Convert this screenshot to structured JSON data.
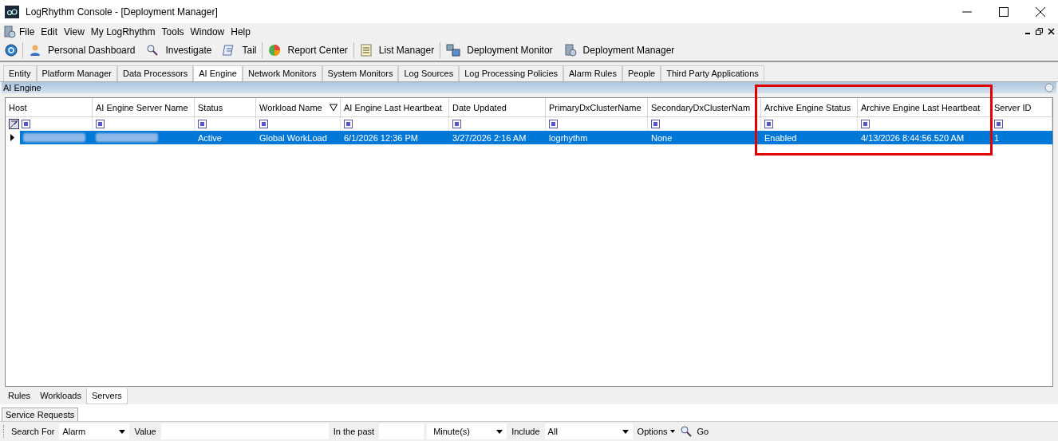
{
  "window": {
    "title": "LogRhythm Console - [Deployment Manager]"
  },
  "menu": [
    "File",
    "Edit",
    "View",
    "My LogRhythm",
    "Tools",
    "Window",
    "Help"
  ],
  "toolbar": [
    "Personal Dashboard",
    "Investigate",
    "Tail",
    "Report Center",
    "List Manager",
    "Deployment Monitor",
    "Deployment Manager"
  ],
  "tabs": [
    {
      "label": "Entity",
      "selected": false
    },
    {
      "label": "Platform Manager",
      "selected": false
    },
    {
      "label": "Data Processors",
      "selected": false
    },
    {
      "label": "AI Engine",
      "selected": true
    },
    {
      "label": "Network Monitors",
      "selected": false
    },
    {
      "label": "System Monitors",
      "selected": false
    },
    {
      "label": "Log Sources",
      "selected": false
    },
    {
      "label": "Log Processing Policies",
      "selected": false
    },
    {
      "label": "Alarm Rules",
      "selected": false
    },
    {
      "label": "People",
      "selected": false
    },
    {
      "label": "Third Party Applications",
      "selected": false
    }
  ],
  "panel": {
    "title": "AI Engine"
  },
  "table": {
    "columns": [
      {
        "label": "Host",
        "filtered": false,
        "highlighted": false
      },
      {
        "label": "AI Engine Server Name",
        "filtered": false,
        "highlighted": false
      },
      {
        "label": "Status",
        "filtered": false,
        "highlighted": false
      },
      {
        "label": "Workload Name",
        "filtered": true,
        "highlighted": false
      },
      {
        "label": "AI Engine Last Heartbeat",
        "filtered": false,
        "highlighted": false
      },
      {
        "label": "Date Updated",
        "filtered": false,
        "highlighted": false
      },
      {
        "label": "PrimaryDxClusterName",
        "filtered": false,
        "highlighted": false
      },
      {
        "label": "SecondaryDxClusterNam",
        "filtered": false,
        "highlighted": false
      },
      {
        "label": "Archive Engine Status",
        "filtered": false,
        "highlighted": true
      },
      {
        "label": "Archive Engine Last Heartbeat",
        "filtered": false,
        "highlighted": true
      },
      {
        "label": "Server ID",
        "filtered": false,
        "highlighted": false
      }
    ],
    "rows": [
      {
        "selected": true,
        "cells": [
          {
            "kind": "redacted"
          },
          {
            "kind": "redacted"
          },
          {
            "kind": "text",
            "text": "Active"
          },
          {
            "kind": "text",
            "text": "Global WorkLoad"
          },
          {
            "kind": "text",
            "text": "6/1/2026 12:36 PM"
          },
          {
            "kind": "text",
            "text": "3/27/2026 2:16 AM"
          },
          {
            "kind": "text",
            "text": "logrhythm"
          },
          {
            "kind": "text",
            "text": "None"
          },
          {
            "kind": "text",
            "text": "Enabled"
          },
          {
            "kind": "text",
            "text": "4/13/2026 8:44:56.520 AM"
          },
          {
            "kind": "text",
            "text": "1"
          }
        ]
      }
    ]
  },
  "bottom_tabs": [
    {
      "label": "Rules",
      "selected": false
    },
    {
      "label": "Workloads",
      "selected": false
    },
    {
      "label": "Servers",
      "selected": true
    }
  ],
  "service_tab": {
    "label": "Service Requests"
  },
  "search_bar": {
    "search_for_label": "Search For",
    "search_for_value": "Alarm",
    "value_label": "Value",
    "in_the_past_label": "In the past",
    "unit_value": "Minute(s)",
    "include_label": "Include",
    "include_value": "All",
    "options_label": "Options",
    "go_label": "Go"
  }
}
